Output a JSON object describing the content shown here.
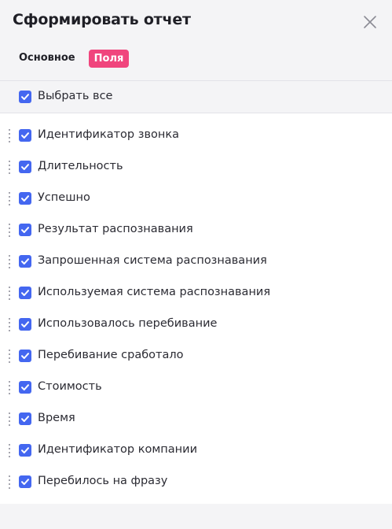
{
  "dialog": {
    "title": "Сформировать отчет"
  },
  "tabs": [
    {
      "label": "Основное",
      "active": false
    },
    {
      "label": "Поля",
      "active": true
    }
  ],
  "select_all": {
    "label": "Выбрать все",
    "checked": true
  },
  "fields": [
    {
      "label": "Идентификатор звонка",
      "checked": true
    },
    {
      "label": "Длительность",
      "checked": true
    },
    {
      "label": "Успешно",
      "checked": true
    },
    {
      "label": "Результат распознавания",
      "checked": true
    },
    {
      "label": "Запрошенная система распознавания",
      "checked": true
    },
    {
      "label": "Используемая система распознавания",
      "checked": true
    },
    {
      "label": "Использовалось перебивание",
      "checked": true
    },
    {
      "label": "Перебивание сработало",
      "checked": true
    },
    {
      "label": "Стоимость",
      "checked": true
    },
    {
      "label": "Время",
      "checked": true
    },
    {
      "label": "Идентификатор компании",
      "checked": true
    },
    {
      "label": "Перебилось на фразу",
      "checked": true
    }
  ],
  "colors": {
    "accent_tab": "#f0457d",
    "checkbox": "#4467f0"
  }
}
